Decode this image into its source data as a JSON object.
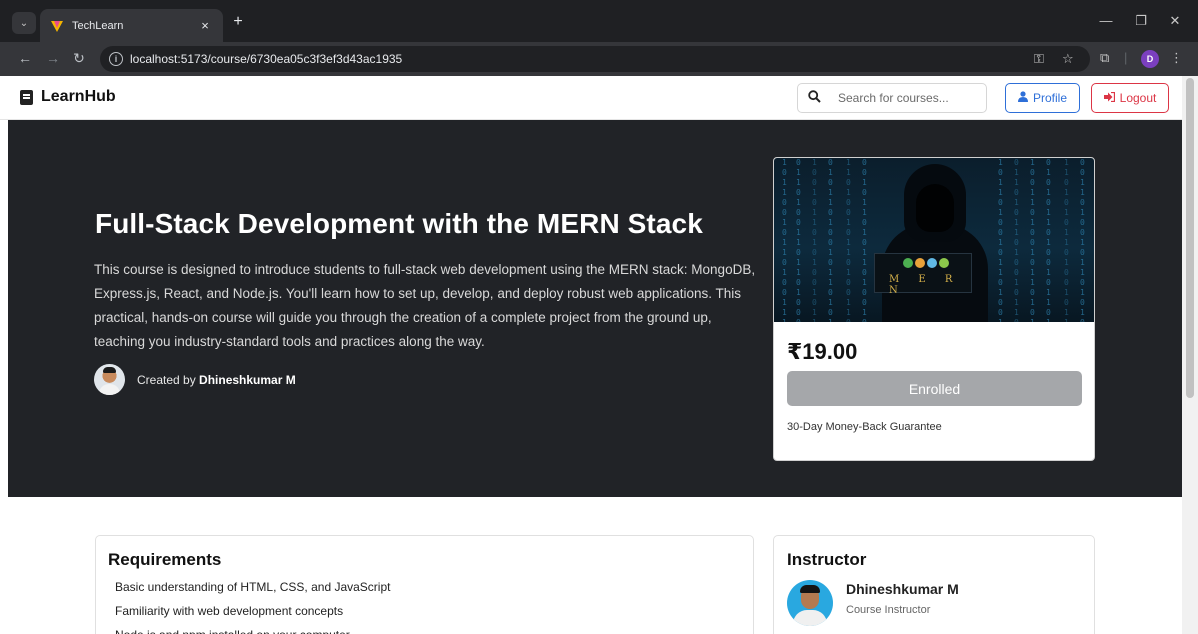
{
  "browser": {
    "tab_title": "TechLearn",
    "tab_close": "×",
    "new_tab": "+",
    "url": "localhost:5173/course/6730ea05c3f3ef3d43ac1935",
    "profile_initial": "D"
  },
  "navbar": {
    "brand": "LearnHub",
    "search_placeholder": "Search for courses...",
    "profile_label": "Profile",
    "logout_label": "Logout"
  },
  "hero": {
    "title": "Full-Stack Development with the MERN Stack",
    "description": "This course is designed to introduce students to full-stack web development using the MERN stack: MongoDB, Express.js, React, and Node.js. You'll learn how to set up, develop, and deploy robust web applications. This practical, hands-on course will guide you through the creation of a complete project from the ground up, teaching you industry-standard tools and practices along the way.",
    "created_by_prefix": "Created by",
    "creator_name": "Dhineshkumar M"
  },
  "course_card": {
    "image_text": "M E R N",
    "price": "₹19.00",
    "enroll_label": "Enrolled",
    "guarantee": "30-Day Money-Back Guarantee"
  },
  "requirements": {
    "title": "Requirements",
    "items": [
      "Basic understanding of HTML, CSS, and JavaScript",
      "Familiarity with web development concepts",
      "Node.js and npm installed on your computer"
    ]
  },
  "instructor": {
    "title": "Instructor",
    "name": "Dhineshkumar M",
    "role": "Course Instructor"
  },
  "colors": {
    "hero_bg": "#212327",
    "primary": "#2e6fd8",
    "danger": "#dc3545",
    "enrolled_btn": "#a5a7aa"
  }
}
